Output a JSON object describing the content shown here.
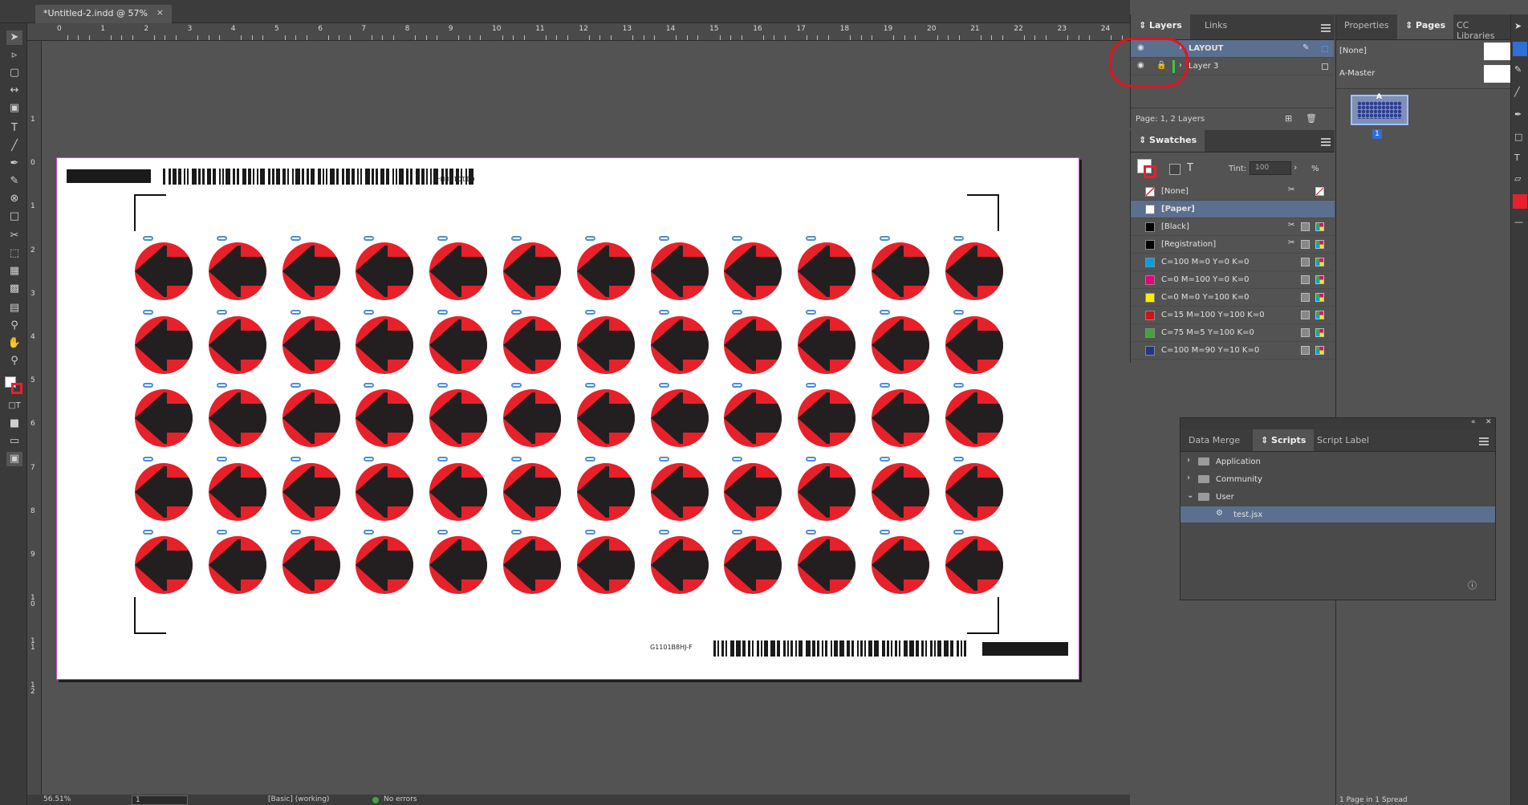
{
  "document": {
    "tab_title": "*Untitled-2.indd @ 57%",
    "close": "×"
  },
  "ruler": {
    "top_labels": [
      "0",
      "1",
      "2",
      "3",
      "4",
      "5",
      "6",
      "7",
      "8",
      "9",
      "10",
      "11",
      "12",
      "13",
      "14",
      "15",
      "16",
      "17",
      "18",
      "19",
      "20",
      "21",
      "22",
      "23",
      "24"
    ],
    "left_labels": [
      "1",
      "0",
      "1",
      "2",
      "3",
      "4",
      "5",
      "6",
      "7",
      "8",
      "9",
      "1 0",
      "1 1",
      "1 2"
    ]
  },
  "page_content": {
    "barcode_text_top": "G1101B8H-F",
    "barcode_text_bottom": "G1101B8HJ-F",
    "disc_rows": 5,
    "disc_cols": 12
  },
  "statusbar": {
    "zoom": "56.51%",
    "page": "1",
    "style": "[Basic] (working)",
    "preflight": "No errors"
  },
  "layers_panel": {
    "tabs": [
      "Layers",
      "Links"
    ],
    "layers": [
      {
        "name": "LAYOUT",
        "selected": true
      },
      {
        "name": "Layer 3",
        "selected": false
      }
    ],
    "footer": "Page: 1, 2 Layers"
  },
  "swatches_panel": {
    "title": "Swatches",
    "tint_label": "Tint:",
    "tint_value": "100",
    "tint_unit": "%",
    "swatches": [
      {
        "name": "[None]",
        "color": "#ffffff"
      },
      {
        "name": "[Paper]",
        "color": "#ffffff"
      },
      {
        "name": "[Black]",
        "color": "#000000"
      },
      {
        "name": "[Registration]",
        "color": "#000000"
      },
      {
        "name": "C=100 M=0 Y=0 K=0",
        "color": "#00a0e3"
      },
      {
        "name": "C=0 M=100 Y=0 K=0",
        "color": "#e5007e"
      },
      {
        "name": "C=0 M=0 Y=100 K=0",
        "color": "#ffed00"
      },
      {
        "name": "C=15 M=100 Y=100 K=0",
        "color": "#d0121c"
      },
      {
        "name": "C=75 M=5 Y=100 K=0",
        "color": "#3aa935"
      },
      {
        "name": "C=100 M=90 Y=10 K=0",
        "color": "#23358b"
      }
    ]
  },
  "pages_panel": {
    "tabs": [
      "Properties",
      "Pages",
      "CC Libraries"
    ],
    "masters": [
      "[None]",
      "A-Master"
    ],
    "page_thumb_label": "A",
    "page_number": "1",
    "footer": "1 Page in 1 Spread"
  },
  "scripts_panel": {
    "tabs": [
      "Data Merge",
      "Scripts",
      "Script Label"
    ],
    "tree": [
      {
        "name": "Application",
        "type": "folder"
      },
      {
        "name": "Community",
        "type": "folder"
      },
      {
        "name": "User",
        "type": "folder"
      },
      {
        "name": "test.jsx",
        "type": "script"
      }
    ]
  },
  "colors": {
    "accent_select": "#5b6f8e",
    "annotation": "#e8111a",
    "disc_red": "#e8202a"
  }
}
